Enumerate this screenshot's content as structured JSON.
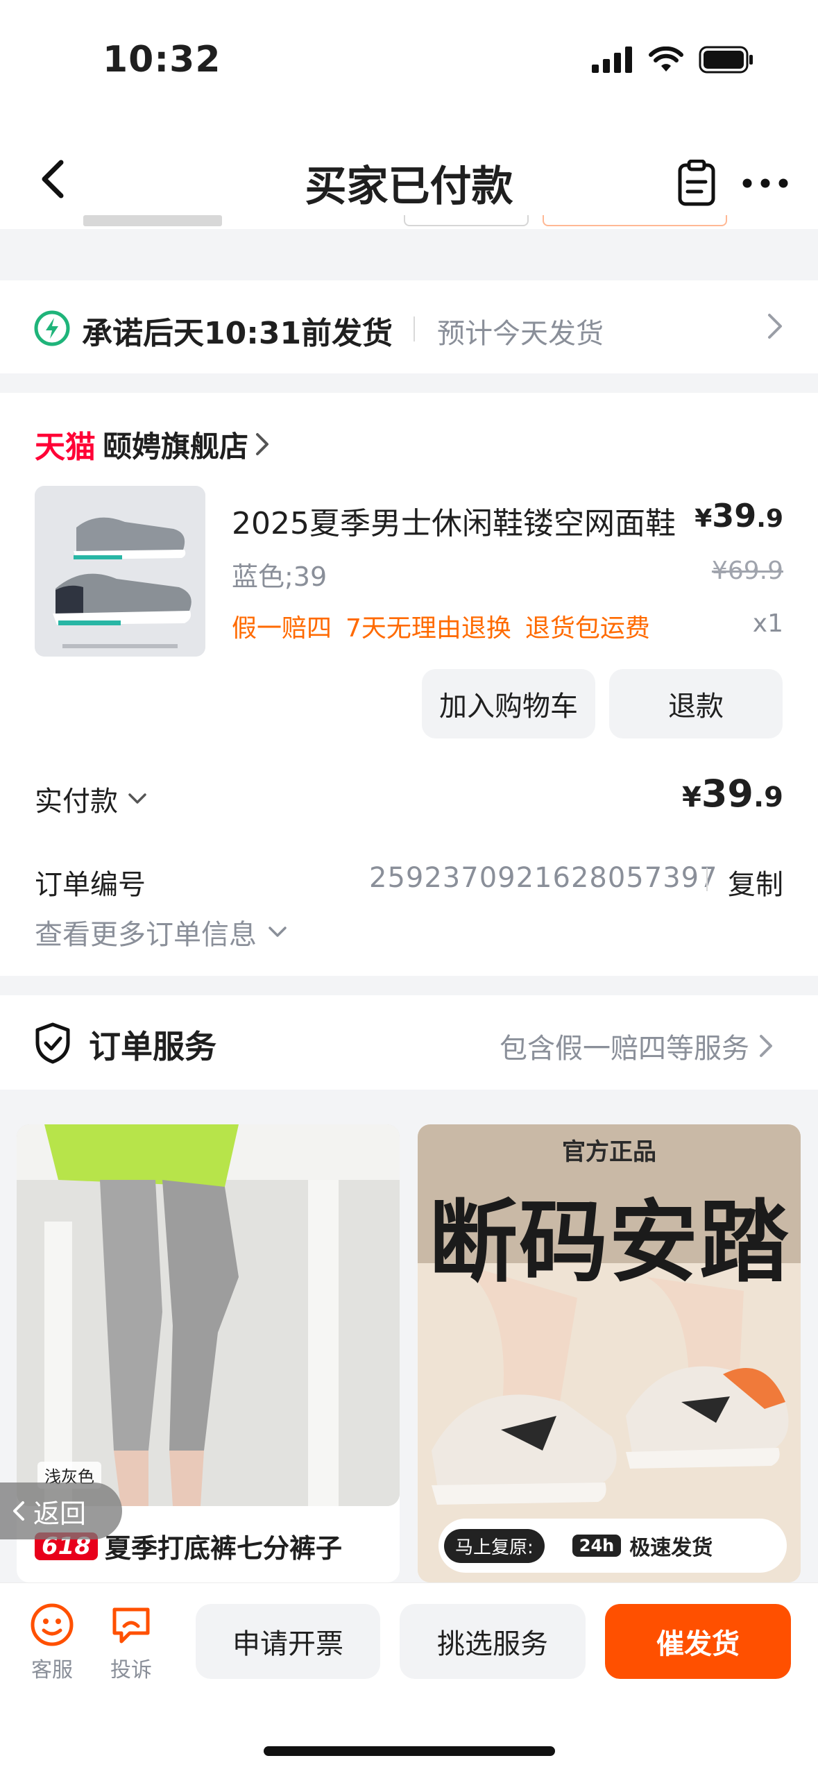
{
  "status_bar": {
    "time": "10:32"
  },
  "nav": {
    "title": "买家已付款"
  },
  "shipping": {
    "promise": "承诺后天10:31前发货",
    "estimate": "预计今天发货"
  },
  "shop": {
    "platform": "天猫",
    "name": "颐娉旗舰店"
  },
  "product": {
    "title": "2025夏季男士休闲鞋镂空网面鞋",
    "currency": "¥",
    "price_int": "39",
    "price_dec": ".9",
    "sku": "蓝色;39",
    "original_price": "¥69.9",
    "tags": [
      "假一赔四",
      "7天无理由退换",
      "退货包运费"
    ],
    "quantity": "x1"
  },
  "actions": {
    "add_cart": "加入购物车",
    "refund": "退款"
  },
  "payment": {
    "label": "实付款",
    "currency": "¥",
    "amount_int": "39",
    "amount_dec": ".9"
  },
  "order_info": {
    "number_label": "订单编号",
    "number": "2592370921628057397",
    "copy": "复制",
    "more": "查看更多订单信息"
  },
  "service": {
    "title": "订单服务",
    "summary": "包含假一赔四等服务"
  },
  "recommendations": [
    {
      "swatch": "浅灰色",
      "badge": "618",
      "title": "夏季打底裤七分裤子"
    },
    {
      "headline": "官方正品",
      "slogan": "断码安踏",
      "footer_left": "马上复原:",
      "footer_badge": "24h",
      "footer_right": "极速发货"
    }
  ],
  "float_back": "返回",
  "bottom_bar": {
    "customer_service": "客服",
    "complaint": "投诉",
    "invoice": "申请开票",
    "pick_service": "挑选服务",
    "urge_ship": "催发货"
  },
  "colors": {
    "accent": "#ff5000",
    "tmall": "#ff0036",
    "tag": "#ff6a00",
    "ship_icon": "#1fb47a"
  }
}
